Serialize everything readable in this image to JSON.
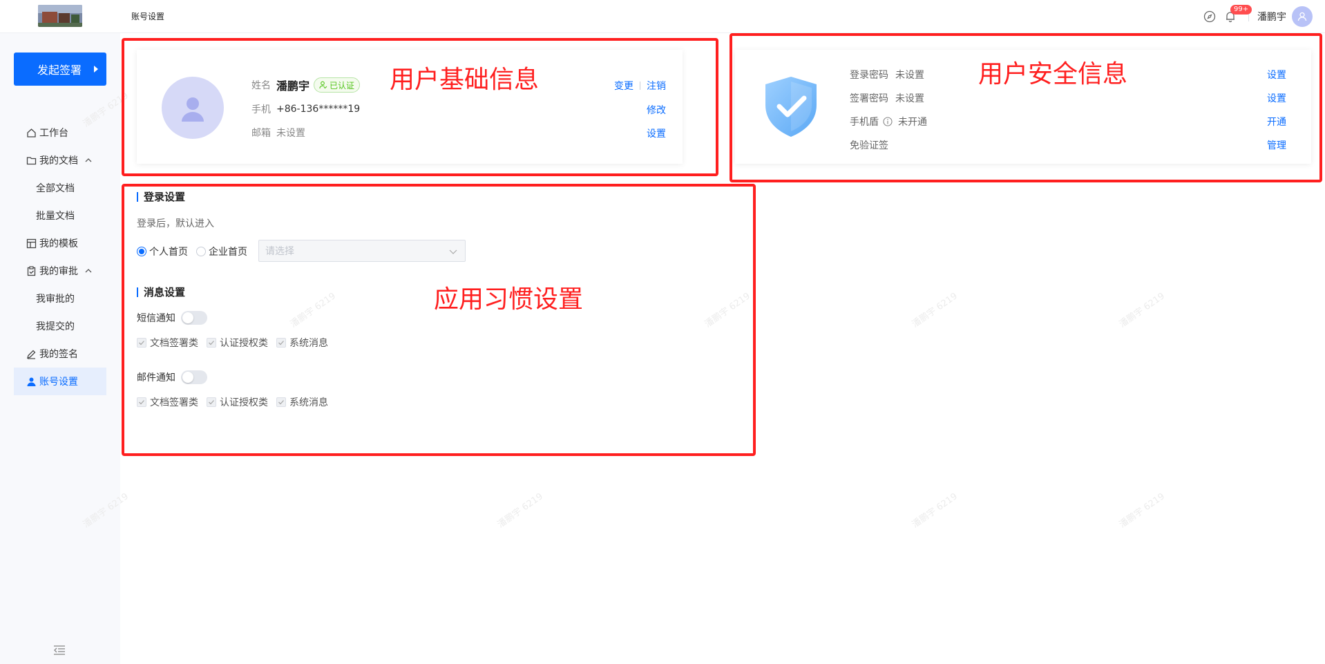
{
  "header": {
    "title": "账号设置",
    "badge": "99+",
    "user_name": "潘鹏宇"
  },
  "sidebar": {
    "start_button": "发起签署",
    "items": [
      {
        "label": "工作台"
      },
      {
        "label": "我的文档"
      },
      {
        "label": "全部文档"
      },
      {
        "label": "批量文档"
      },
      {
        "label": "我的模板"
      },
      {
        "label": "我的审批"
      },
      {
        "label": "我审批的"
      },
      {
        "label": "我提交的"
      },
      {
        "label": "我的签名"
      },
      {
        "label": "账号设置"
      }
    ]
  },
  "profile": {
    "name_label": "姓名",
    "name": "潘鹏宇",
    "verified": "已认证",
    "phone_label": "手机",
    "phone": "+86-136******19",
    "email_label": "邮箱",
    "email": "未设置",
    "change": "变更",
    "cancel": "注销",
    "modify": "修改",
    "set": "设置"
  },
  "security": {
    "rows": [
      {
        "label": "登录密码",
        "value": "未设置",
        "action": "设置"
      },
      {
        "label": "签署密码",
        "value": "未设置",
        "action": "设置"
      },
      {
        "label": "手机盾",
        "value": "未开通",
        "action": "开通"
      },
      {
        "label": "免验证签",
        "value": "",
        "action": "管理"
      }
    ]
  },
  "login_settings": {
    "title": "登录设置",
    "hint": "登录后，默认进入",
    "option_personal": "个人首页",
    "option_company": "企业首页",
    "select_placeholder": "请选择"
  },
  "message_settings": {
    "title": "消息设置",
    "sms_label": "短信通知",
    "email_label": "邮件通知",
    "sms_on": false,
    "email_on": false,
    "checks": [
      "文档签署类",
      "认证授权类",
      "系统消息"
    ]
  },
  "annotations": {
    "basic": "用户基础信息",
    "security": "用户安全信息",
    "habits": "应用习惯设置"
  },
  "watermark": "潘鹏宇 6219",
  "colors": {
    "primary": "#0a6cff",
    "annotation": "#ff1f1f",
    "verified": "#52c41a"
  }
}
